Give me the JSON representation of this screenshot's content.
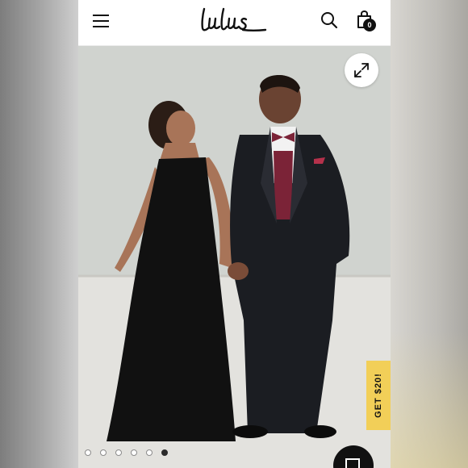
{
  "app": {
    "brand": "Lulus"
  },
  "header": {
    "menu_icon": "hamburger-menu-icon",
    "search_icon": "search-icon",
    "bag_icon": "shopping-bag-icon",
    "cart_count": "0"
  },
  "hero": {
    "expand_icon": "expand-arrows-icon",
    "promo_label": "GET $20!",
    "carousel": {
      "total": 6,
      "active_index": 5
    }
  },
  "chat": {
    "icon": "chat-icon"
  },
  "colors": {
    "accent_yellow": "#f2cf58",
    "burgundy": "#7b2337",
    "black": "#111111"
  }
}
